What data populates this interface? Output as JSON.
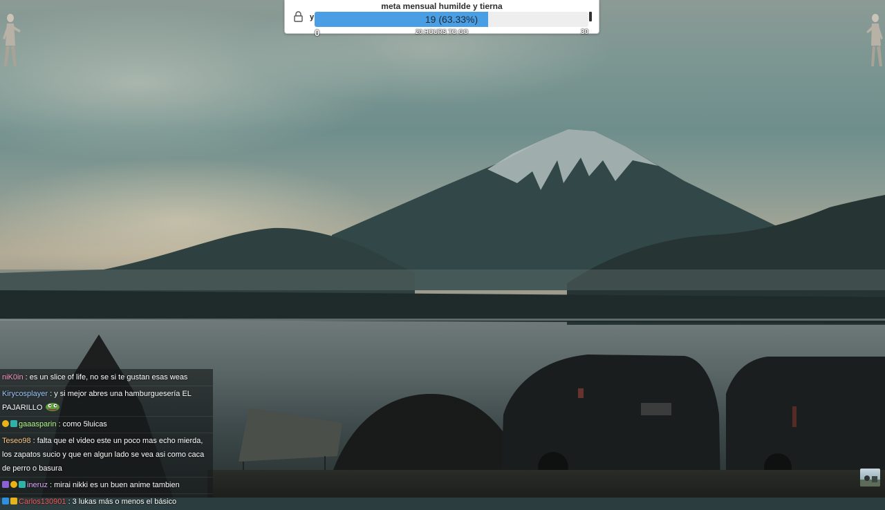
{
  "goal": {
    "title": "meta mensual humilde y tierna",
    "progress_text": "19 (63.33%)",
    "current": 19,
    "target": 30,
    "progress_fraction": 0.6333,
    "min_label": "0",
    "max_label": "30",
    "time_left": "20 HOURS TO GO",
    "left_mark": "y",
    "lock_icon": "lock-icon",
    "fill_color": "#4a9ee3"
  },
  "chat": {
    "messages": [
      {
        "user": "niK0in",
        "user_color": "#ff9ec7",
        "badges": [],
        "text": ": es un slice of life, no se si te gustan esas weas",
        "emote": ""
      },
      {
        "user": "Kirycosplayer",
        "user_color": "#9ec5ff",
        "badges": [],
        "text": ": y si mejor abres una hamburguesería EL PAJARILLO",
        "emote": "pepe-frog-emote"
      },
      {
        "user": "gaaasparin",
        "user_color": "#b6ff8c",
        "badges": [
          "gold-badge",
          "teal-badge"
        ],
        "text": ": como 5luicas",
        "emote": ""
      },
      {
        "user": "Teseo98",
        "user_color": "#ffc88a",
        "badges": [],
        "text": ": falta que el video este un poco mas echo mierda, los zapatos sucio y que en algun lado se vea asi como caca de perro o basura",
        "emote": ""
      },
      {
        "user": "ineruz",
        "user_color": "#e0a8ff",
        "badges": [
          "purple-badge",
          "gold-badge",
          "teal-badge"
        ],
        "text": ": mirai nikki es un buen anime tambien",
        "emote": ""
      },
      {
        "user": "Carlos130901",
        "user_color": "#ff5a5a",
        "badges": [
          "blue-badge",
          "crown-badge"
        ],
        "text": ": 3 lukas más o menos el básico",
        "emote": ""
      }
    ]
  },
  "overlay": {
    "left_figure": "dancing-figure-icon",
    "right_figure": "dancing-figure-icon",
    "corner_thumbnail": "webcam-thumbnail"
  }
}
